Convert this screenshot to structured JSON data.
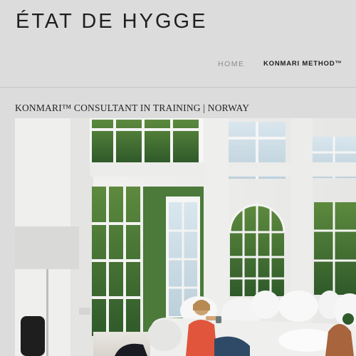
{
  "header": {
    "logo": "ÉTAT DE HYGGE",
    "nav": [
      {
        "label": "HOME",
        "active": false
      },
      {
        "label": "KONMARI METHOD™",
        "active": true
      }
    ]
  },
  "main": {
    "subtitle": "KONMARI™ CONSULTANT IN TRAINING | NORWAY",
    "hero": {
      "subject": "bright room with large arched windows, woman on white sofa drinking from a mug"
    }
  },
  "colors": {
    "header_bg": "#dcdcdc",
    "text": "#1f1f1f",
    "nav_muted": "#8c8c8c"
  }
}
